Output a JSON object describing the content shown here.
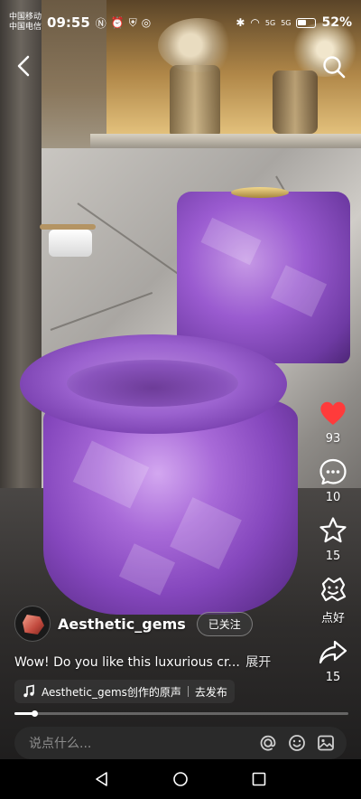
{
  "status_bar": {
    "carrier_1": "中国移动",
    "carrier_2": "中国电信",
    "time": "09:55",
    "signal_1": "5G",
    "signal_2": "5G",
    "battery": "52%",
    "battery_level": 0.52
  },
  "post": {
    "author": "Aesthetic_gems",
    "follow_state": "已关注",
    "caption": "Wow! Do you like this luxurious cr...",
    "expand_label": "展开",
    "music": "Aesthetic_gems创作的原声",
    "publish_label": "去发布",
    "progress": 0.06
  },
  "actions": {
    "likes": "93",
    "comments": "10",
    "favorites": "15",
    "recommend_label": "点好",
    "shares": "15"
  },
  "comment_bar": {
    "placeholder": "说点什么..."
  },
  "colors": {
    "like_red": "#ff3b3b",
    "accent_purple": "#9b5cd0"
  }
}
